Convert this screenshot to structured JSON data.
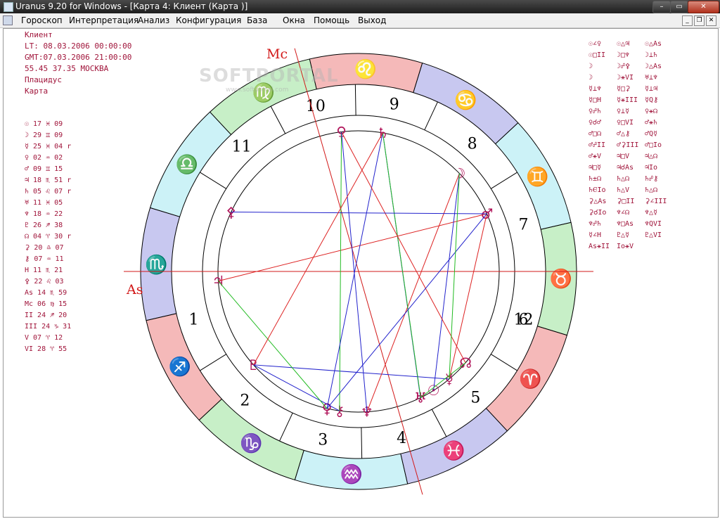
{
  "window": {
    "title": "Uranus 9.20 for Windows - [Карта 4: Клиент      (Карта )]",
    "min": "–",
    "max": "▭",
    "close": "✕"
  },
  "menu": [
    "Гороскоп",
    "Интерпретация",
    "Анализ",
    "Конфигурация",
    "База",
    "Окна",
    "Помощь",
    "Выход"
  ],
  "mdi": {
    "min": "_",
    "restore": "❐",
    "close": "✕"
  },
  "info": [
    "Клиент",
    "LT: 08.03.2006 00:00:00",
    "GMT:07.03.2006 21:00:00",
    "55.45 37.35 МОСКВА",
    "Плацидус",
    "Карта"
  ],
  "planets": [
    "☉ 17 ♓ 09",
    "☽ 29 ♊ 09",
    "☿ 25 ♓ 04 r",
    "♀ 02 ♒ 02",
    "♂ 09 ♊ 15",
    "♃ 18 ♏ 51 r",
    "♄ 05 ♌ 07 r",
    "♅ 11 ♓ 05",
    "♆ 18 ♒ 22",
    "♇ 26 ♐ 38",
    "☊ 04 ♈ 30 r",
    "⚳ 20 ♎ 07",
    "⚷ 07 ♒ 11",
    "H 11 ♏ 21",
    "⚴ 22 ♌ 03",
    "As 14 ♏ 59",
    "Mc 06 ♍ 15",
    "II 24 ♐ 20",
    "III 24 ♑ 31",
    "V 07 ♈ 12",
    "VI 28 ♈ 55"
  ],
  "aspects": [
    [
      "☉∠♀",
      "☉△♃",
      "☉△As"
    ],
    [
      "☉□II",
      "☽□♆",
      "☽⊥♄"
    ],
    [
      "☽",
      "☽☍⚴",
      "☽△As"
    ],
    [
      "☽",
      "☽⚹VI",
      "♅⊥♆"
    ],
    [
      "☿⊥♆",
      "☿□⚳",
      "☿⊥♃"
    ],
    [
      "☿□H",
      "☿⚹III",
      "☿Q⚷"
    ],
    [
      "♀☍♄",
      "♀⊥☿",
      "♀⚹☊"
    ],
    [
      "♀☌♂",
      "♀□VI",
      "♂⚹♄"
    ],
    [
      "♂□☊",
      "♂△⚷",
      "♂Q☿"
    ],
    [
      "♂☍II",
      "♂⚳III",
      "♂□Io"
    ],
    [
      "♂⚹V",
      "♃□V",
      "♃△☊"
    ],
    [
      "♃□☿",
      "♃☌As",
      "♃Io"
    ],
    [
      "♄±☊",
      "♄△☊",
      "♄☍⚷"
    ],
    [
      "♄ⲈIo",
      "♄△V",
      "♄△☊"
    ],
    [
      "⚳△As",
      "⚳□II",
      "⚳∠III"
    ],
    [
      "⚳☌Io",
      "♆∠☊",
      "♆△☿"
    ],
    [
      "♆☍♄",
      "♆□As",
      "♆QVI"
    ],
    [
      "☿∠H",
      "♇△☿",
      "♇△VI"
    ],
    [
      "As⚹II",
      "Io⚹V",
      ""
    ]
  ],
  "chart": {
    "signs": [
      "♏",
      "♐",
      "♑",
      "♒",
      "♓",
      "♈",
      "♉",
      "♊",
      "♋",
      "♌",
      "♍",
      "♎"
    ],
    "sign_colors": [
      "#c8c8f0",
      "#f5b9b9",
      "#c7efc7",
      "#ccf2f7",
      "#c8c8f0",
      "#f5b9b9",
      "#c7efc7",
      "#ccf2f7",
      "#c8c8f0",
      "#f5b9b9",
      "#c7efc7",
      "#ccf2f7"
    ],
    "house_labels": [
      "1",
      "2",
      "3",
      "4",
      "5",
      "6",
      "7",
      "8",
      "9",
      "10",
      "11",
      "12"
    ],
    "angle_labels": {
      "asc": "As",
      "mc": "Mc"
    },
    "planets": [
      {
        "glyph": "♇",
        "lon": 266.6
      },
      {
        "glyph": "♃",
        "lon": 228.9
      },
      {
        "glyph": "♅",
        "lon": 341.1
      },
      {
        "glyph": "♆",
        "lon": 318.4
      },
      {
        "glyph": "⚷",
        "lon": 307.2
      },
      {
        "glyph": "♀",
        "lon": 302.0
      },
      {
        "glyph": "☿",
        "lon": 355.1
      },
      {
        "glyph": "☉",
        "lon": 347.2
      },
      {
        "glyph": "♅",
        "lon": 341.2
      },
      {
        "glyph": "☊",
        "lon": 4.5
      },
      {
        "glyph": "♂",
        "lon": 69.2
      },
      {
        "glyph": "☽",
        "lon": 89.2
      },
      {
        "glyph": "♄",
        "lon": 125.1
      },
      {
        "glyph": "♀",
        "lon": 142.0
      },
      {
        "glyph": "⚴",
        "lon": 200.0
      }
    ],
    "aspect_lines_colors": {
      "blue": "#2222cc",
      "red": "#dd2222",
      "green": "#22bb22"
    }
  },
  "watermark": {
    "main": "SOFTPORTAL",
    "sub": "www.softportal.com"
  }
}
